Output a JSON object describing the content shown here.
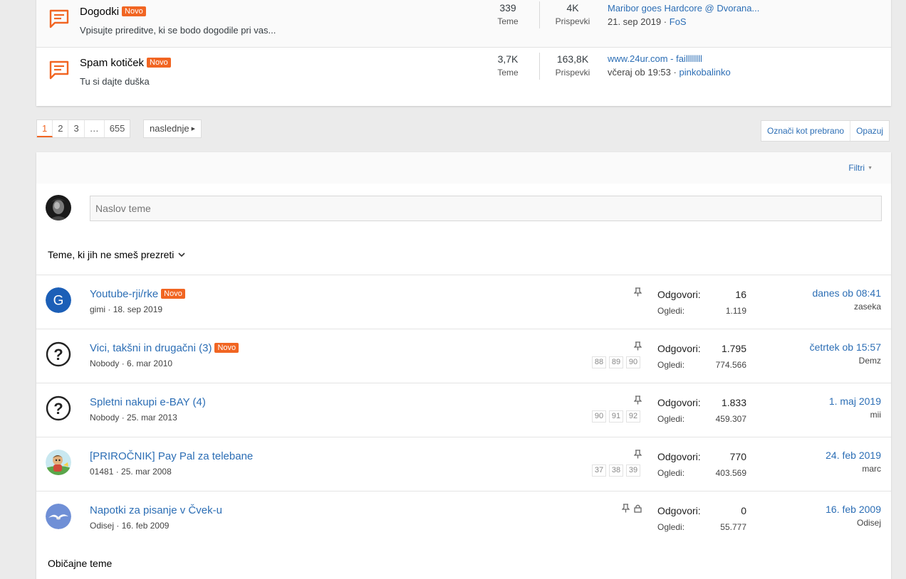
{
  "forums": [
    {
      "title": "Dogodki",
      "badge": "Novo",
      "description": "Vpisujte prireditve, ki se bodo dogodile pri vas...",
      "topics_count": "339",
      "topics_label": "Teme",
      "posts_count": "4K",
      "posts_label": "Prispevki",
      "last_title": "Maribor goes Hardcore @ Dvorana...",
      "last_date": "21. sep 2019",
      "last_user": "FoS"
    },
    {
      "title": "Spam kotiček",
      "badge": "Novo",
      "description": "Tu si dajte duška",
      "topics_count": "3,7K",
      "topics_label": "Teme",
      "posts_count": "163,8K",
      "posts_label": "Prispevki",
      "last_title": "www.24ur.com - faillllllll",
      "last_date": "včeraj ob 19:53",
      "last_user": "pinkobalinko"
    }
  ],
  "pagination": {
    "pages": [
      "1",
      "2",
      "3",
      "…",
      "655"
    ],
    "active": "1",
    "next_label": "naslednje"
  },
  "actions": {
    "mark_read": "Označi kot prebrano",
    "watch": "Opazuj"
  },
  "filters_label": "Filtri",
  "new_topic_placeholder": "Naslov teme",
  "sections": {
    "pinned": "Teme, ki jih ne smeš prezreti",
    "normal": "Običajne teme"
  },
  "labels": {
    "replies": "Odgovori:",
    "views": "Ogledi:"
  },
  "topics": [
    {
      "title": "Youtube-rji/rke",
      "badge": "Novo",
      "author": "gimi",
      "date": "18. sep 2019",
      "pages": [],
      "locked": false,
      "replies": "16",
      "views": "1.119",
      "last_date": "danes ob 08:41",
      "last_user": "zaseka",
      "avatar": "letter-g"
    },
    {
      "title": "Vici, takšni in drugačni (3)",
      "badge": "Novo",
      "author": "Nobody",
      "date": "6. mar 2010",
      "pages": [
        "88",
        "89",
        "90"
      ],
      "locked": false,
      "replies": "1.795",
      "views": "774.566",
      "last_date": "četrtek ob 15:57",
      "last_user": "Demz",
      "avatar": "question-mark"
    },
    {
      "title": "Spletni nakupi e-BAY (4)",
      "badge": "",
      "author": "Nobody",
      "date": "25. mar 2013",
      "pages": [
        "90",
        "91",
        "92"
      ],
      "locked": false,
      "replies": "1.833",
      "views": "459.307",
      "last_date": "1. maj 2019",
      "last_user": "mii",
      "avatar": "question-mark"
    },
    {
      "title": "[PRIROČNIK] Pay Pal za telebane",
      "badge": "",
      "author": "01481",
      "date": "25. mar 2008",
      "pages": [
        "37",
        "38",
        "39"
      ],
      "locked": false,
      "replies": "770",
      "views": "403.569",
      "last_date": "24. feb 2019",
      "last_user": "marc",
      "avatar": "cartoon"
    },
    {
      "title": "Napotki za pisanje v Čvek-u",
      "badge": "",
      "author": "Odisej",
      "date": "16. feb 2009",
      "pages": [],
      "locked": true,
      "replies": "0",
      "views": "55.777",
      "last_date": "16. feb 2009",
      "last_user": "Odisej",
      "avatar": "seagull"
    }
  ],
  "colors": {
    "accent": "#f16522",
    "link": "#2c6eb5",
    "background": "#ebebeb"
  }
}
